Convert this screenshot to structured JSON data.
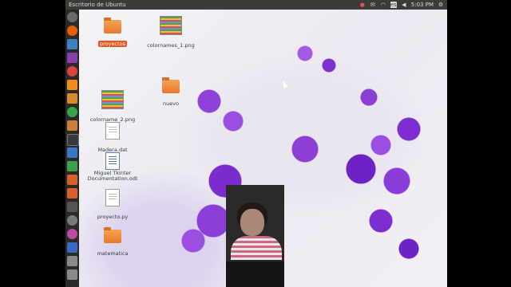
{
  "topbar": {
    "title": "Escritorio de Ubuntu",
    "time": "5:03 PM",
    "tray_icons": [
      "record-icon",
      "mail-icon",
      "wifi-icon",
      "keyboard-layout-icon",
      "volume-icon",
      "gear-icon"
    ],
    "keyboard_layout": "es"
  },
  "launcher": {
    "items": [
      {
        "name": "dash-home-icon",
        "color": "#6a6a6a"
      },
      {
        "name": "firefox-icon",
        "color": "#e66000"
      },
      {
        "name": "thunderbird-icon",
        "color": "#3a82c4"
      },
      {
        "name": "app-purple-icon",
        "color": "#8a3fb0"
      },
      {
        "name": "chrome-icon",
        "color": "#d9453b"
      },
      {
        "name": "vlc-icon",
        "color": "#f28a1e"
      },
      {
        "name": "sublime-icon",
        "color": "#d98a2e"
      },
      {
        "name": "app-green-icon",
        "color": "#3aa34a"
      },
      {
        "name": "files-icon",
        "color": "#c9803a"
      },
      {
        "name": "terminal-icon",
        "color": "#3a3a3a"
      },
      {
        "name": "writer-icon",
        "color": "#3a78c4"
      },
      {
        "name": "calc-icon",
        "color": "#3aa34a"
      },
      {
        "name": "impress-icon",
        "color": "#d9602a"
      },
      {
        "name": "software-center-icon",
        "color": "#d9602a"
      },
      {
        "name": "amazon-icon",
        "color": "#555555"
      },
      {
        "name": "settings-icon",
        "color": "#7a7a7a"
      },
      {
        "name": "app-pink-icon",
        "color": "#c04aa0"
      },
      {
        "name": "app-blue-icon",
        "color": "#3a6ac4"
      },
      {
        "name": "drive-icon",
        "color": "#8a8a8a"
      },
      {
        "name": "trash-icon",
        "color": "#8a8a8a"
      }
    ]
  },
  "desktop": {
    "items": [
      {
        "label": "proyectos",
        "selected": true
      },
      {
        "label": "colornames_1.png"
      },
      {
        "label": "nuevo"
      },
      {
        "label": "colorname_2.png"
      },
      {
        "label": "Madera.dat"
      },
      {
        "label": "Miguel Tkinter Documentation.odt"
      },
      {
        "label": "proyecto.py"
      },
      {
        "label": "matematica"
      }
    ]
  }
}
